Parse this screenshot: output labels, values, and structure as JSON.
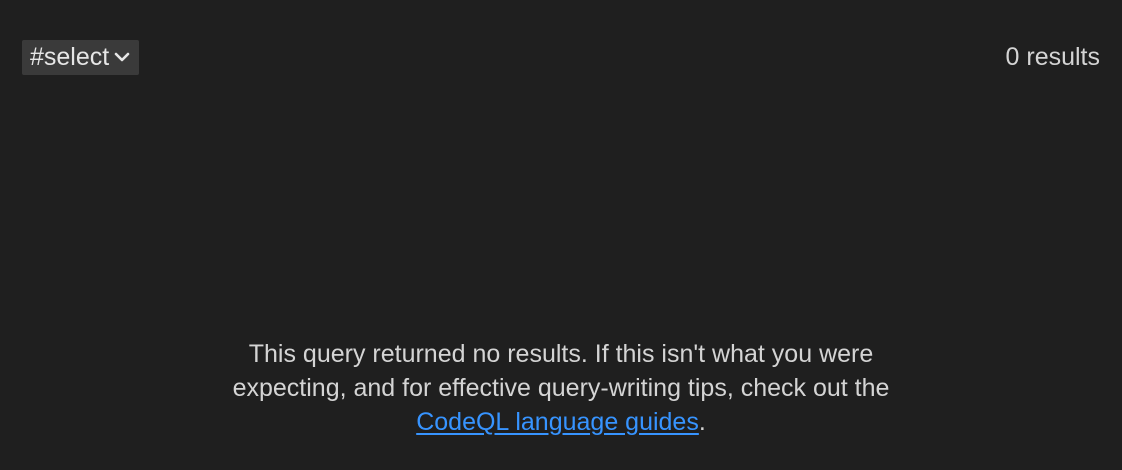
{
  "toolbar": {
    "result_set_select": {
      "selected_value": "#select",
      "icon": "chevron-down-icon"
    },
    "result_count": "0 results"
  },
  "empty_state": {
    "line1": "This query returned no results. If this isn't what you were",
    "line2": "expecting, and for effective query-writing tips, check out the",
    "link_text": "CodeQL language guides",
    "trailing": "."
  },
  "colors": {
    "background": "#1f1f1f",
    "select_background": "#3a3a3a",
    "text": "#d4d4d4",
    "link": "#3794ff"
  }
}
